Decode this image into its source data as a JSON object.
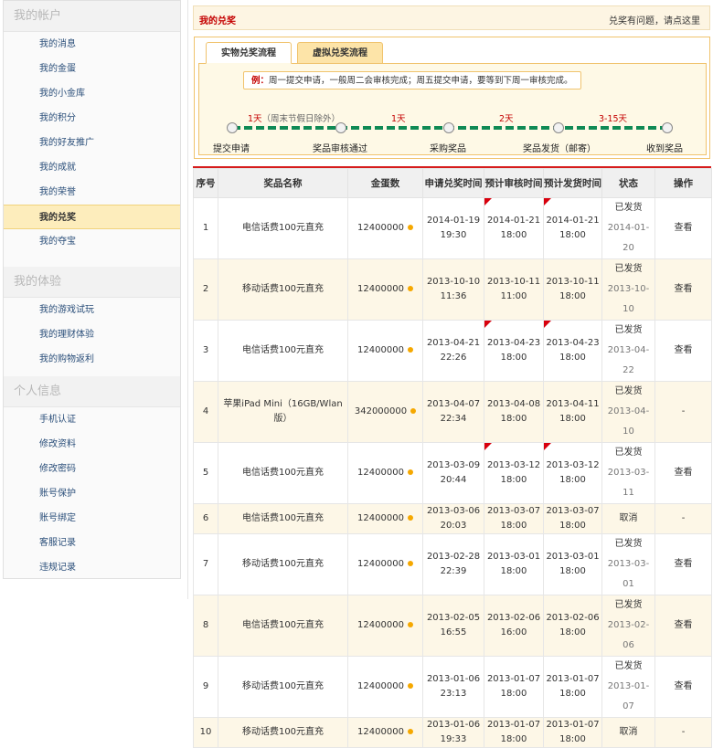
{
  "sidebar": {
    "sections": [
      {
        "title": "我的帐户",
        "items": [
          "我的消息",
          "我的金蛋",
          "我的小金库",
          "我的积分",
          "我的好友推广",
          "我的成就",
          "我的荣誉",
          "我的兑奖",
          "我的夺宝"
        ]
      },
      {
        "title": "我的体验",
        "items": [
          "我的游戏试玩",
          "我的理财体验",
          "我的购物返利"
        ]
      },
      {
        "title": "个人信息",
        "items": [
          "手机认证",
          "修改资料",
          "修改密码",
          "账号保护",
          "账号绑定",
          "客服记录",
          "违规记录"
        ]
      }
    ],
    "active_item": "我的兑奖"
  },
  "header": {
    "title": "我的兑奖",
    "help_link": "兑奖有问题，请点这里"
  },
  "flow": {
    "tabs": [
      "实物兑奖流程",
      "虚拟兑奖流程"
    ],
    "note_prefix": "例：",
    "note_text": "周一提交申请，一般周二会审核完成；周五提交申请，要等到下周一审核完成。",
    "durations": [
      {
        "main": "1天",
        "sub": "（周末节假日除外）"
      },
      {
        "main": "1天",
        "sub": ""
      },
      {
        "main": "2天",
        "sub": ""
      },
      {
        "main": "3-15天",
        "sub": ""
      }
    ],
    "steps": [
      "提交申请",
      "奖品审核通过",
      "采购奖品",
      "奖品发货（邮寄）",
      "收到奖品"
    ],
    "colors": {
      "track": "#0f8a55",
      "accent": "#c40000"
    }
  },
  "table": {
    "headers": [
      "序号",
      "奖品名称",
      "金蛋数",
      "申请兑奖时间",
      "预计审核时间",
      "预计发货时间",
      "状态",
      "操作"
    ],
    "rows": [
      {
        "no": "1",
        "name": "电信话费100元直充",
        "eggs": "12400000",
        "apply": [
          "2014-01-19",
          "19:30"
        ],
        "review": [
          "2014-01-21",
          "18:00"
        ],
        "ship": [
          "2014-01-21",
          "18:00"
        ],
        "status": "已发货",
        "status_date": "2014-01-20",
        "op": "查看",
        "flag_review": true,
        "flag_ship": true
      },
      {
        "no": "2",
        "name": "移动话费100元直充",
        "eggs": "12400000",
        "apply": [
          "2013-10-10",
          "11:36"
        ],
        "review": [
          "2013-10-11",
          "11:00"
        ],
        "ship": [
          "2013-10-11",
          "18:00"
        ],
        "status": "已发货",
        "status_date": "2013-10-10",
        "op": "查看",
        "flag_review": false,
        "flag_ship": false
      },
      {
        "no": "3",
        "name": "电信话费100元直充",
        "eggs": "12400000",
        "apply": [
          "2013-04-21",
          "22:26"
        ],
        "review": [
          "2013-04-23",
          "18:00"
        ],
        "ship": [
          "2013-04-23",
          "18:00"
        ],
        "status": "已发货",
        "status_date": "2013-04-22",
        "op": "查看",
        "flag_review": true,
        "flag_ship": true
      },
      {
        "no": "4",
        "name": "苹果iPad Mini（16GB/Wlan版）",
        "eggs": "342000000",
        "apply": [
          "2013-04-07",
          "22:34"
        ],
        "review": [
          "2013-04-08",
          "18:00"
        ],
        "ship": [
          "2013-04-11",
          "18:00"
        ],
        "status": "已发货",
        "status_date": "2013-04-10",
        "op": "-",
        "flag_review": false,
        "flag_ship": false
      },
      {
        "no": "5",
        "name": "电信话费100元直充",
        "eggs": "12400000",
        "apply": [
          "2013-03-09",
          "20:44"
        ],
        "review": [
          "2013-03-12",
          "18:00"
        ],
        "ship": [
          "2013-03-12",
          "18:00"
        ],
        "status": "已发货",
        "status_date": "2013-03-11",
        "op": "查看",
        "flag_review": true,
        "flag_ship": true
      },
      {
        "no": "6",
        "name": "电信话费100元直充",
        "eggs": "12400000",
        "apply": [
          "2013-03-06",
          "20:03"
        ],
        "review": [
          "2013-03-07",
          "18:00"
        ],
        "ship": [
          "2013-03-07",
          "18:00"
        ],
        "status": "取消",
        "status_date": "",
        "op": "-",
        "flag_review": false,
        "flag_ship": false
      },
      {
        "no": "7",
        "name": "移动话费100元直充",
        "eggs": "12400000",
        "apply": [
          "2013-02-28",
          "22:39"
        ],
        "review": [
          "2013-03-01",
          "18:00"
        ],
        "ship": [
          "2013-03-01",
          "18:00"
        ],
        "status": "已发货",
        "status_date": "2013-03-01",
        "op": "查看",
        "flag_review": false,
        "flag_ship": false
      },
      {
        "no": "8",
        "name": "电信话费100元直充",
        "eggs": "12400000",
        "apply": [
          "2013-02-05",
          "16:55"
        ],
        "review": [
          "2013-02-06",
          "16:00"
        ],
        "ship": [
          "2013-02-06",
          "18:00"
        ],
        "status": "已发货",
        "status_date": "2013-02-06",
        "op": "查看",
        "flag_review": false,
        "flag_ship": false
      },
      {
        "no": "9",
        "name": "移动话费100元直充",
        "eggs": "12400000",
        "apply": [
          "2013-01-06",
          "23:13"
        ],
        "review": [
          "2013-01-07",
          "18:00"
        ],
        "ship": [
          "2013-01-07",
          "18:00"
        ],
        "status": "已发货",
        "status_date": "2013-01-07",
        "op": "查看",
        "flag_review": false,
        "flag_ship": false
      },
      {
        "no": "10",
        "name": "移动话费100元直充",
        "eggs": "12400000",
        "apply": [
          "2013-01-06",
          "19:33"
        ],
        "review": [
          "2013-01-07",
          "18:00"
        ],
        "ship": [
          "2013-01-07",
          "18:00"
        ],
        "status": "取消",
        "status_date": "",
        "op": "-",
        "flag_review": false,
        "flag_ship": false
      }
    ]
  }
}
